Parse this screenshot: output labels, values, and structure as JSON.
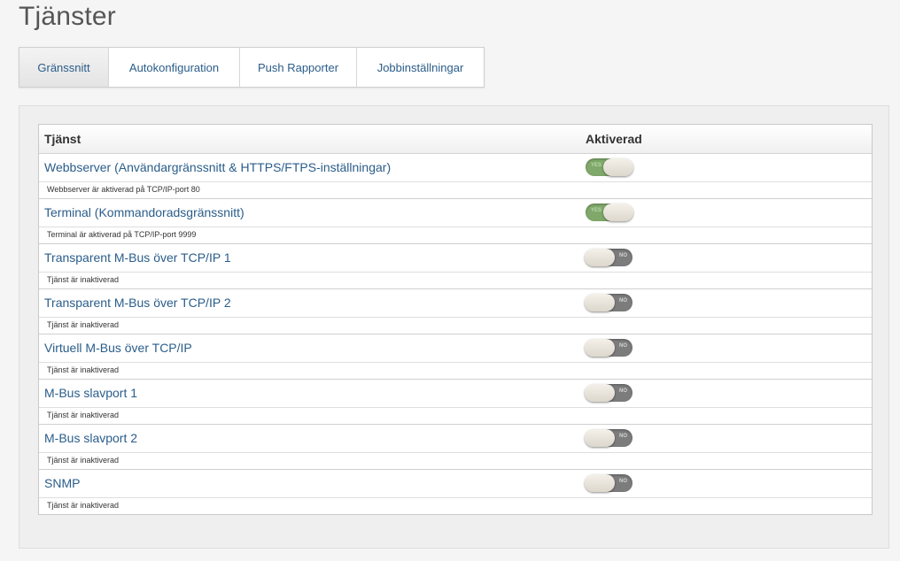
{
  "page": {
    "title": "Tjänster"
  },
  "tabs": [
    {
      "label": "Gränssnitt",
      "active": true
    },
    {
      "label": "Autokonfiguration",
      "active": false
    },
    {
      "label": "Push Rapporter",
      "active": false
    },
    {
      "label": "Jobbinställningar",
      "active": false
    }
  ],
  "table": {
    "col_service": "Tjänst",
    "col_enabled": "Aktiverad",
    "rows": [
      {
        "name": "Webbserver (Användargränssnitt & HTTPS/FTPS-inställningar)",
        "enabled": true,
        "toggle_text": "YES",
        "status": "Webbserver är aktiverad på TCP/IP-port 80"
      },
      {
        "name": "Terminal (Kommandoradsgränssnitt)",
        "enabled": true,
        "toggle_text": "YES",
        "status": "Terminal är aktiverad på TCP/IP-port 9999"
      },
      {
        "name": "Transparent M-Bus över TCP/IP 1",
        "enabled": false,
        "toggle_text": "NO",
        "status": "Tjänst är inaktiverad"
      },
      {
        "name": "Transparent M-Bus över TCP/IP 2",
        "enabled": false,
        "toggle_text": "NO",
        "status": "Tjänst är inaktiverad"
      },
      {
        "name": "Virtuell M-Bus över TCP/IP",
        "enabled": false,
        "toggle_text": "NO",
        "status": "Tjänst är inaktiverad"
      },
      {
        "name": "M-Bus slavport 1",
        "enabled": false,
        "toggle_text": "NO",
        "status": "Tjänst är inaktiverad"
      },
      {
        "name": "M-Bus slavport 2",
        "enabled": false,
        "toggle_text": "NO",
        "status": "Tjänst är inaktiverad"
      },
      {
        "name": "SNMP",
        "enabled": false,
        "toggle_text": "NO",
        "status": "Tjänst är inaktiverad"
      }
    ]
  },
  "colors": {
    "link": "#2a5d8a",
    "toggle_on": "#7fa86a",
    "toggle_off": "#7c7c7c"
  }
}
